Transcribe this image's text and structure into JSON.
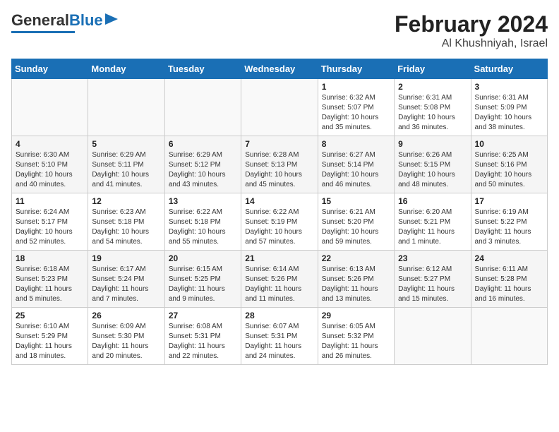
{
  "header": {
    "logo_general": "General",
    "logo_blue": "Blue",
    "title": "February 2024",
    "subtitle": "Al Khushniyah, Israel"
  },
  "days_of_week": [
    "Sunday",
    "Monday",
    "Tuesday",
    "Wednesday",
    "Thursday",
    "Friday",
    "Saturday"
  ],
  "weeks": [
    [
      {
        "day": "",
        "info": ""
      },
      {
        "day": "",
        "info": ""
      },
      {
        "day": "",
        "info": ""
      },
      {
        "day": "",
        "info": ""
      },
      {
        "day": "1",
        "info": "Sunrise: 6:32 AM\nSunset: 5:07 PM\nDaylight: 10 hours\nand 35 minutes."
      },
      {
        "day": "2",
        "info": "Sunrise: 6:31 AM\nSunset: 5:08 PM\nDaylight: 10 hours\nand 36 minutes."
      },
      {
        "day": "3",
        "info": "Sunrise: 6:31 AM\nSunset: 5:09 PM\nDaylight: 10 hours\nand 38 minutes."
      }
    ],
    [
      {
        "day": "4",
        "info": "Sunrise: 6:30 AM\nSunset: 5:10 PM\nDaylight: 10 hours\nand 40 minutes."
      },
      {
        "day": "5",
        "info": "Sunrise: 6:29 AM\nSunset: 5:11 PM\nDaylight: 10 hours\nand 41 minutes."
      },
      {
        "day": "6",
        "info": "Sunrise: 6:29 AM\nSunset: 5:12 PM\nDaylight: 10 hours\nand 43 minutes."
      },
      {
        "day": "7",
        "info": "Sunrise: 6:28 AM\nSunset: 5:13 PM\nDaylight: 10 hours\nand 45 minutes."
      },
      {
        "day": "8",
        "info": "Sunrise: 6:27 AM\nSunset: 5:14 PM\nDaylight: 10 hours\nand 46 minutes."
      },
      {
        "day": "9",
        "info": "Sunrise: 6:26 AM\nSunset: 5:15 PM\nDaylight: 10 hours\nand 48 minutes."
      },
      {
        "day": "10",
        "info": "Sunrise: 6:25 AM\nSunset: 5:16 PM\nDaylight: 10 hours\nand 50 minutes."
      }
    ],
    [
      {
        "day": "11",
        "info": "Sunrise: 6:24 AM\nSunset: 5:17 PM\nDaylight: 10 hours\nand 52 minutes."
      },
      {
        "day": "12",
        "info": "Sunrise: 6:23 AM\nSunset: 5:18 PM\nDaylight: 10 hours\nand 54 minutes."
      },
      {
        "day": "13",
        "info": "Sunrise: 6:22 AM\nSunset: 5:18 PM\nDaylight: 10 hours\nand 55 minutes."
      },
      {
        "day": "14",
        "info": "Sunrise: 6:22 AM\nSunset: 5:19 PM\nDaylight: 10 hours\nand 57 minutes."
      },
      {
        "day": "15",
        "info": "Sunrise: 6:21 AM\nSunset: 5:20 PM\nDaylight: 10 hours\nand 59 minutes."
      },
      {
        "day": "16",
        "info": "Sunrise: 6:20 AM\nSunset: 5:21 PM\nDaylight: 11 hours\nand 1 minute."
      },
      {
        "day": "17",
        "info": "Sunrise: 6:19 AM\nSunset: 5:22 PM\nDaylight: 11 hours\nand 3 minutes."
      }
    ],
    [
      {
        "day": "18",
        "info": "Sunrise: 6:18 AM\nSunset: 5:23 PM\nDaylight: 11 hours\nand 5 minutes."
      },
      {
        "day": "19",
        "info": "Sunrise: 6:17 AM\nSunset: 5:24 PM\nDaylight: 11 hours\nand 7 minutes."
      },
      {
        "day": "20",
        "info": "Sunrise: 6:15 AM\nSunset: 5:25 PM\nDaylight: 11 hours\nand 9 minutes."
      },
      {
        "day": "21",
        "info": "Sunrise: 6:14 AM\nSunset: 5:26 PM\nDaylight: 11 hours\nand 11 minutes."
      },
      {
        "day": "22",
        "info": "Sunrise: 6:13 AM\nSunset: 5:26 PM\nDaylight: 11 hours\nand 13 minutes."
      },
      {
        "day": "23",
        "info": "Sunrise: 6:12 AM\nSunset: 5:27 PM\nDaylight: 11 hours\nand 15 minutes."
      },
      {
        "day": "24",
        "info": "Sunrise: 6:11 AM\nSunset: 5:28 PM\nDaylight: 11 hours\nand 16 minutes."
      }
    ],
    [
      {
        "day": "25",
        "info": "Sunrise: 6:10 AM\nSunset: 5:29 PM\nDaylight: 11 hours\nand 18 minutes."
      },
      {
        "day": "26",
        "info": "Sunrise: 6:09 AM\nSunset: 5:30 PM\nDaylight: 11 hours\nand 20 minutes."
      },
      {
        "day": "27",
        "info": "Sunrise: 6:08 AM\nSunset: 5:31 PM\nDaylight: 11 hours\nand 22 minutes."
      },
      {
        "day": "28",
        "info": "Sunrise: 6:07 AM\nSunset: 5:31 PM\nDaylight: 11 hours\nand 24 minutes."
      },
      {
        "day": "29",
        "info": "Sunrise: 6:05 AM\nSunset: 5:32 PM\nDaylight: 11 hours\nand 26 minutes."
      },
      {
        "day": "",
        "info": ""
      },
      {
        "day": "",
        "info": ""
      }
    ]
  ]
}
